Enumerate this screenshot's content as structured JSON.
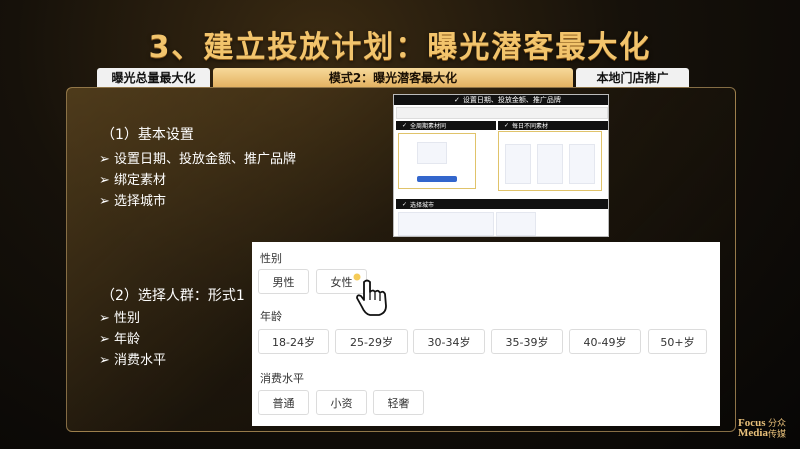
{
  "title": "3、建立投放计划：曝光潜客最大化",
  "tabs": {
    "left": "曝光总量最大化",
    "middle": "模式2：曝光潜客最大化",
    "right": "本地门店推广"
  },
  "section1": {
    "title": "（1）基本设置",
    "bullets": [
      "设置日期、投放金额、推广品牌",
      "绑定素材",
      "选择城市"
    ]
  },
  "section2": {
    "title": "（2）选择人群：形式1",
    "bullets": [
      "性别",
      "年龄",
      "消费水平"
    ]
  },
  "screenshot": {
    "header": "设置日期、投放金额、推广品牌",
    "row_left": "全周期素材同",
    "row_right": "每日不同素材",
    "city": "选择城市"
  },
  "targeting": {
    "gender_label": "性别",
    "gender_options": [
      "男性",
      "女性"
    ],
    "age_label": "年龄",
    "age_options": [
      "18-24岁",
      "25-29岁",
      "30-34岁",
      "35-39岁",
      "40-49岁",
      "50+岁"
    ],
    "consumption_label": "消费水平",
    "consumption_options": [
      "普通",
      "小资",
      "轻奢"
    ]
  },
  "logo": {
    "en_line1": "Focus",
    "en_line2": "Media",
    "cn_line1": "分众",
    "cn_line2": "传媒"
  }
}
